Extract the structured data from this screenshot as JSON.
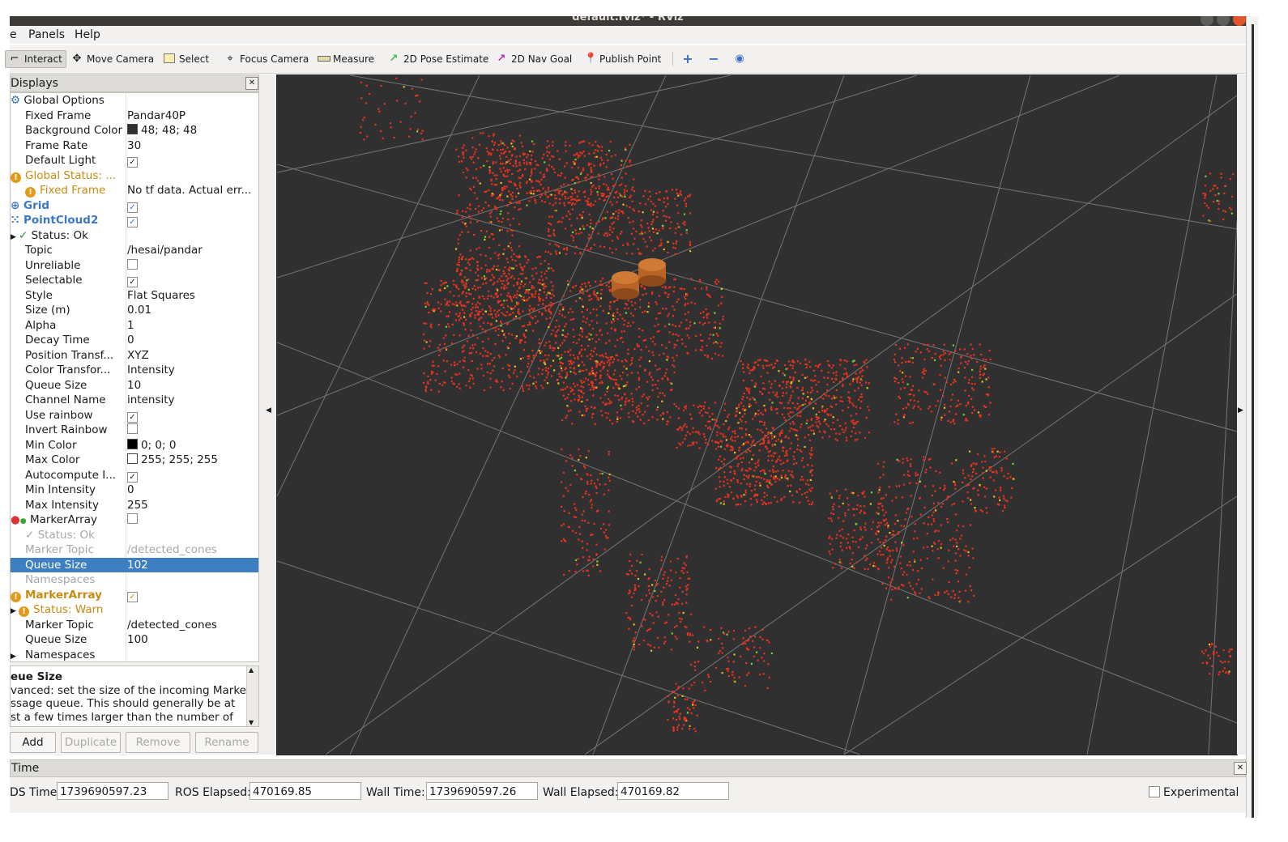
{
  "window": {
    "title": "default.rviz* - RViz"
  },
  "menu": [
    {
      "label": "e"
    },
    {
      "label": "Panels"
    },
    {
      "label": "Help"
    }
  ],
  "toolbar": {
    "tools": [
      {
        "label": "Interact",
        "icon": "interact-icon"
      },
      {
        "label": "Move Camera",
        "icon": "move-camera-icon"
      },
      {
        "label": "Select",
        "icon": "select-icon"
      },
      {
        "label": "Focus Camera",
        "icon": "focus-camera-icon"
      },
      {
        "label": "Measure",
        "icon": "ruler-icon"
      },
      {
        "label": "2D Pose Estimate",
        "icon": "pose-arrow-icon"
      },
      {
        "label": "2D Nav Goal",
        "icon": "nav-goal-arrow-icon"
      },
      {
        "label": "Publish Point",
        "icon": "map-pin-icon"
      }
    ]
  },
  "displays": {
    "title": "Displays",
    "rows": [
      {
        "name": "Global Options",
        "value": ""
      },
      {
        "name": "Fixed Frame",
        "value": "Pandar40P"
      },
      {
        "name": "Background Color",
        "value": "48; 48; 48",
        "swatch": "#303030"
      },
      {
        "name": "Frame Rate",
        "value": "30"
      },
      {
        "name": "Default Light",
        "value": "",
        "check": "✓"
      },
      {
        "name": "Global Status: ...",
        "value": ""
      },
      {
        "name": "Fixed Frame",
        "value": "No tf data.  Actual err..."
      },
      {
        "name": "Grid",
        "value": "",
        "check": "✓"
      },
      {
        "name": "PointCloud2",
        "value": "",
        "check": "✓"
      },
      {
        "name": "Status: Ok",
        "value": ""
      },
      {
        "name": "Topic",
        "value": "/hesai/pandar"
      },
      {
        "name": "Unreliable",
        "value": "",
        "check": ""
      },
      {
        "name": "Selectable",
        "value": "",
        "check": "✓"
      },
      {
        "name": "Style",
        "value": "Flat Squares"
      },
      {
        "name": "Size (m)",
        "value": "0.01"
      },
      {
        "name": "Alpha",
        "value": "1"
      },
      {
        "name": "Decay Time",
        "value": "0"
      },
      {
        "name": "Position Transf...",
        "value": "XYZ"
      },
      {
        "name": "Color Transfor...",
        "value": "Intensity"
      },
      {
        "name": "Queue Size",
        "value": "10"
      },
      {
        "name": "Channel Name",
        "value": "intensity"
      },
      {
        "name": "Use rainbow",
        "value": "",
        "check": "✓"
      },
      {
        "name": "Invert Rainbow",
        "value": "",
        "check": ""
      },
      {
        "name": "Min Color",
        "value": "0; 0; 0",
        "swatch": "#000000"
      },
      {
        "name": "Max Color",
        "value": "255; 255; 255",
        "swatch": "#ffffff"
      },
      {
        "name": "Autocompute I...",
        "value": "",
        "check": "✓"
      },
      {
        "name": "Min Intensity",
        "value": "0"
      },
      {
        "name": "Max Intensity",
        "value": "255"
      },
      {
        "name": "MarkerArray",
        "value": "",
        "check": ""
      },
      {
        "name": "Status: Ok",
        "value": ""
      },
      {
        "name": "Marker Topic",
        "value": "/detected_cones"
      },
      {
        "name": "Queue Size",
        "value": "102"
      },
      {
        "name": "Namespaces",
        "value": ""
      },
      {
        "name": "MarkerArray",
        "value": "",
        "check": "✓"
      },
      {
        "name": "Status: Warn",
        "value": ""
      },
      {
        "name": "Marker Topic",
        "value": "/detected_cones"
      },
      {
        "name": "Queue Size",
        "value": "100"
      },
      {
        "name": "Namespaces",
        "value": ""
      }
    ],
    "help_title": "eue Size",
    "help_lines": [
      "vanced: set the size of the incoming Marker",
      "ssage queue. This should generally be at",
      "st a few times larger than the number of"
    ],
    "buttons": {
      "add": "Add",
      "duplicate": "Duplicate",
      "remove": "Remove",
      "rename": "Rename"
    }
  },
  "time": {
    "title": "Time",
    "ros_time_label": "DS Time:",
    "ros_time": "1739690597.23",
    "ros_elapsed_label": "ROS Elapsed:",
    "ros_elapsed": "470169.85",
    "wall_time_label": "Wall Time:",
    "wall_time": "1739690597.26",
    "wall_elapsed_label": "Wall Elapsed:",
    "wall_elapsed": "470169.82",
    "experimental_label": "Experimental"
  },
  "colors": {
    "viewport_bg": "#303030",
    "points": "#e8321e",
    "selection": "#3d7fc1",
    "warn": "#c98a12",
    "cone": "#b86426"
  }
}
